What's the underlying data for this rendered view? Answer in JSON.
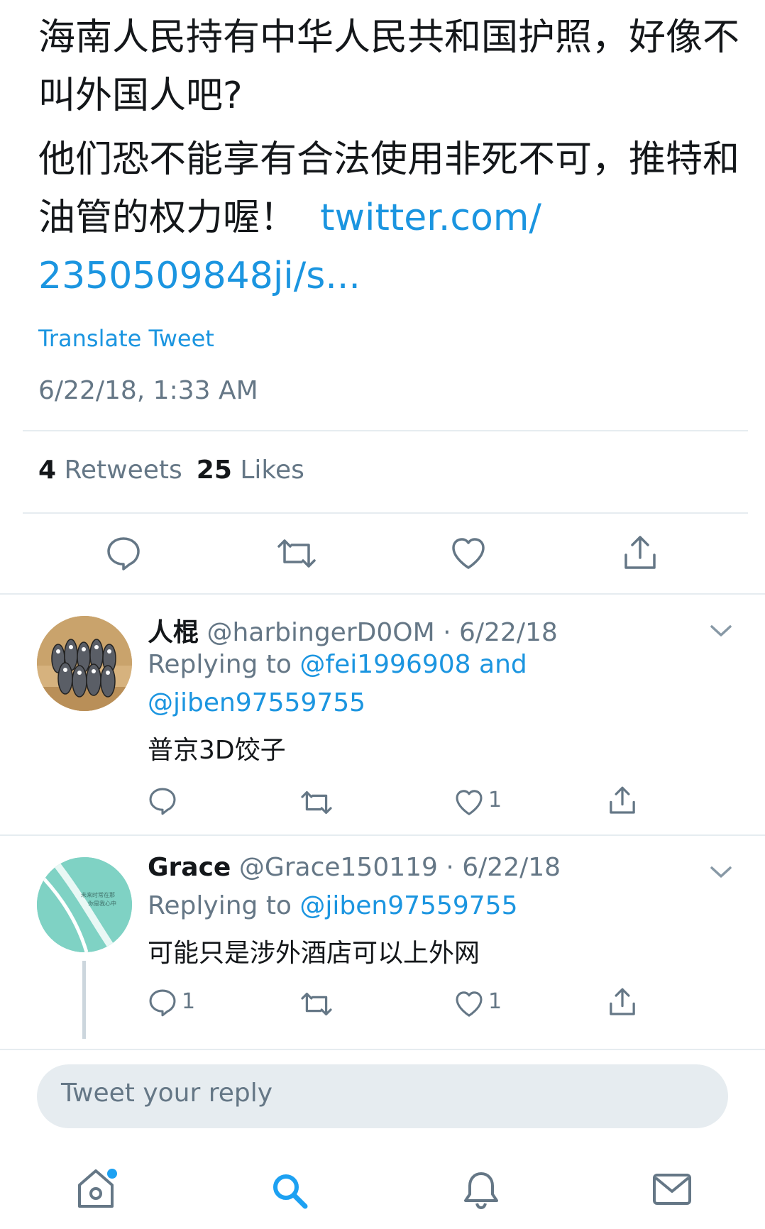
{
  "tweet": {
    "paragraph1": "海南人民持有中华人民共和国护照，好像不叫外国人吧?",
    "paragraph2_text": "他们恐不能享有合法使用非死不可，推特和油管的权力喔！",
    "paragraph2_link_a": "twitter.com/",
    "paragraph2_link_b": "2350509848ji/s...",
    "translate_label": "Translate Tweet",
    "timestamp": "6/22/18, 1:33 AM",
    "retweets_count": "4",
    "retweets_label": "Retweets",
    "likes_count": "25",
    "likes_label": "Likes"
  },
  "replies": [
    {
      "name": "人棍",
      "handle": "@harbingerD0OM",
      "date": "· 6/22/18",
      "replying_prefix": "Replying to",
      "mention1": "@fei1996908",
      "mention_joiner": "and",
      "mention2": "@jiben97559755",
      "text": "普京3D饺子",
      "reply_count": "",
      "like_count": "1"
    },
    {
      "name": "Grace",
      "handle": "@Grace150119",
      "date": "· 6/22/18",
      "replying_prefix": "Replying to",
      "mention1": "@jiben97559755",
      "text": "可能只是涉外酒店可以上外网",
      "reply_count": "1",
      "like_count": "1",
      "avatar_text": "未来时常在那\n你是我心中"
    }
  ],
  "composer": {
    "placeholder": "Tweet your reply"
  },
  "icons": [
    "reply-icon",
    "retweet-icon",
    "like-icon",
    "share-icon",
    "chevron-down-icon",
    "home-icon",
    "search-icon",
    "notifications-icon",
    "messages-icon"
  ],
  "colors": {
    "link": "#1b95e0",
    "text": "#14171a",
    "secondary": "#657786",
    "divider": "#e6ecf0",
    "notification_dot": "#1da1f2",
    "avatar_teal": "#7fd2c4"
  }
}
